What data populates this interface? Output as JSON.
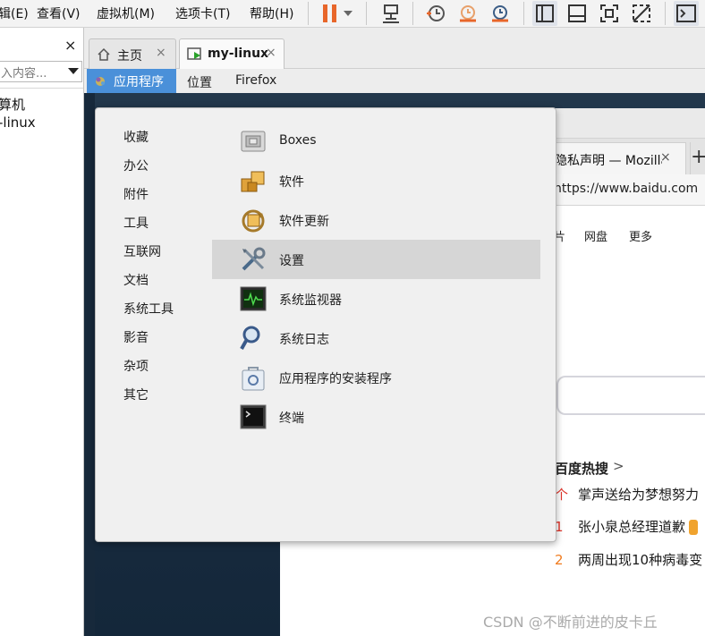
{
  "host_menubar": {
    "items": [
      "辑(E)",
      "查看(V)",
      "虚拟机(M)",
      "选项卡(T)",
      "帮助(H)"
    ]
  },
  "toolbar_icons": [
    "pause-icon",
    "dropdown-arrow-icon",
    "send-keys-icon",
    "snapshot-icon",
    "revert-snapshot-icon",
    "snapshot-manager-icon",
    "library-view-icon",
    "console-view-icon",
    "fullscreen-icon",
    "unity-icon",
    "terminal-icon"
  ],
  "library": {
    "close_glyph": "×",
    "search_placeholder": "入内容...",
    "items": [
      "算机",
      "-linux"
    ]
  },
  "tabs": [
    {
      "label": "主页",
      "icon": "home-icon",
      "close": "×"
    },
    {
      "label": "my-linux",
      "icon": "vm-running-icon",
      "close": "×"
    }
  ],
  "gnome_bar": {
    "applications": "应用程序",
    "places": "位置",
    "firefox": "Firefox"
  },
  "firefox": {
    "tab_title": "隐私声明 — Mozilla",
    "tab_close": "×",
    "new_tab": "+",
    "url": "https://www.baidu.com",
    "links": [
      "片",
      "网盘",
      "更多"
    ],
    "hot_title": "百度热搜",
    "hot_chevron": ">",
    "hot_items": [
      {
        "rank": "个",
        "text": "掌声送给为梦想努力",
        "color": "#e0352b"
      },
      {
        "rank": "1",
        "text": "张小泉总经理道歉",
        "color": "#e0352b"
      },
      {
        "rank": "2",
        "text": "两周出现10种病毒变",
        "color": "#f07b1e"
      }
    ]
  },
  "apps_popup": {
    "categories": [
      "收藏",
      "办公",
      "附件",
      "工具",
      "互联网",
      "文档",
      "系统工具",
      "影音",
      "杂项",
      "其它"
    ],
    "apps": [
      {
        "label": "Boxes",
        "icon": "boxes-icon"
      },
      {
        "label": "软件",
        "icon": "software-icon"
      },
      {
        "label": "软件更新",
        "icon": "software-update-icon"
      },
      {
        "label": "设置",
        "icon": "settings-icon",
        "highlighted": true
      },
      {
        "label": "系统监视器",
        "icon": "system-monitor-icon"
      },
      {
        "label": "系统日志",
        "icon": "system-log-icon"
      },
      {
        "label": "应用程序的安装程序",
        "icon": "app-installer-icon"
      },
      {
        "label": "终端",
        "icon": "terminal-icon"
      }
    ]
  },
  "watermark": "CSDN @不断前进的皮卡丘",
  "colors": {
    "apps_button": "#4a90d9",
    "highlight_row": "#d6d6d6",
    "pause_orange": "#e8662a",
    "desktop": "#1b2f42"
  }
}
